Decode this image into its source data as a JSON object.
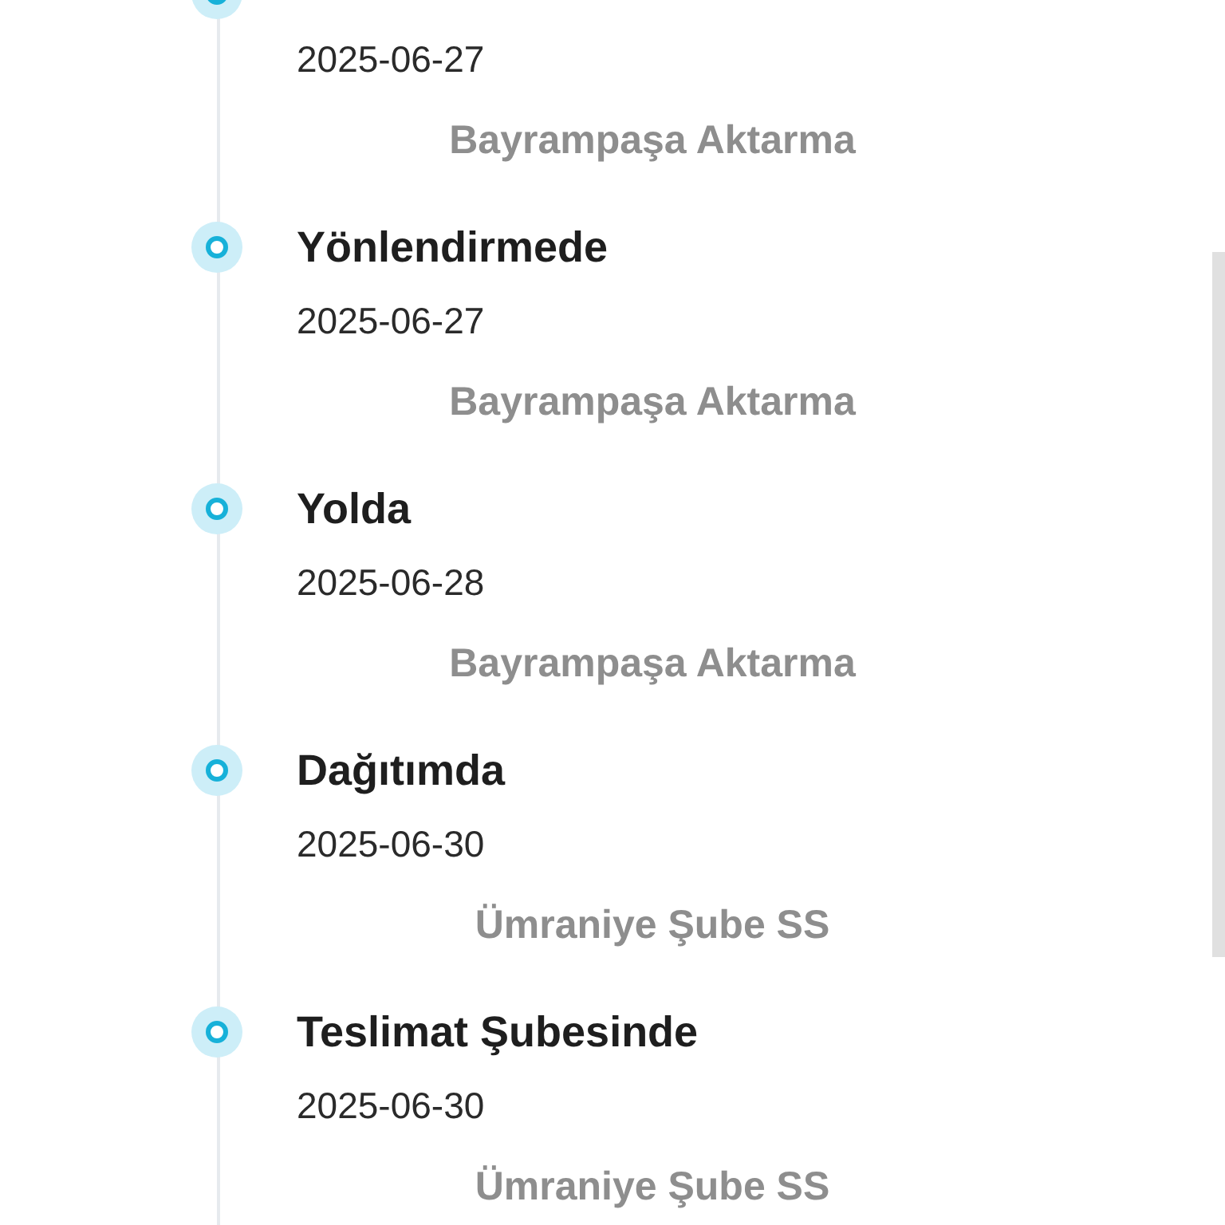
{
  "timeline": [
    {
      "date": "2025-06-27",
      "location": "Bayrampaşa Aktarma"
    },
    {
      "title": "Yönlendirmede",
      "date": "2025-06-27",
      "location": "Bayrampaşa Aktarma"
    },
    {
      "title": "Yolda",
      "date": "2025-06-28",
      "location": "Bayrampaşa Aktarma"
    },
    {
      "title": "Dağıtımda",
      "date": "2025-06-30",
      "location": "Ümraniye Şube SS"
    },
    {
      "title": "Teslimat Şubesinde",
      "date": "2025-06-30",
      "location": "Ümraniye Şube SS"
    }
  ]
}
